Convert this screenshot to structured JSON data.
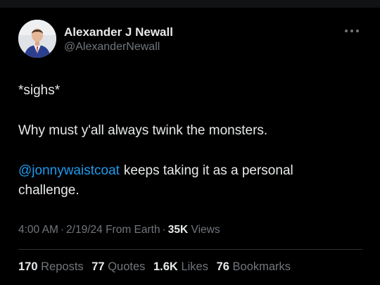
{
  "tweet": {
    "author": {
      "name": "Alexander J Newall",
      "handle": "@AlexanderNewall"
    },
    "text": {
      "line1": "*sighs*",
      "line2": "Why must y'all always twink the monsters.",
      "mention": "@jonnywaistcoat",
      "line3_rest": "keeps taking it as a personal challenge."
    },
    "meta": {
      "time": "4:00 AM",
      "separator": "·",
      "date": "2/19/24",
      "location": "From Earth",
      "views_count": "35K",
      "views_label": "Views"
    },
    "stats": {
      "reposts_count": "170",
      "reposts_label": "Reposts",
      "quotes_count": "77",
      "quotes_label": "Quotes",
      "likes_count": "1.6K",
      "likes_label": "Likes",
      "bookmarks_count": "76",
      "bookmarks_label": "Bookmarks"
    }
  },
  "colors": {
    "background": "#000000",
    "text_primary": "#e7e9ea",
    "text_secondary": "#71767b",
    "link": "#1d9bf0",
    "divider": "#2f3336"
  },
  "icons": {
    "more": "more-horizontal-icon"
  }
}
